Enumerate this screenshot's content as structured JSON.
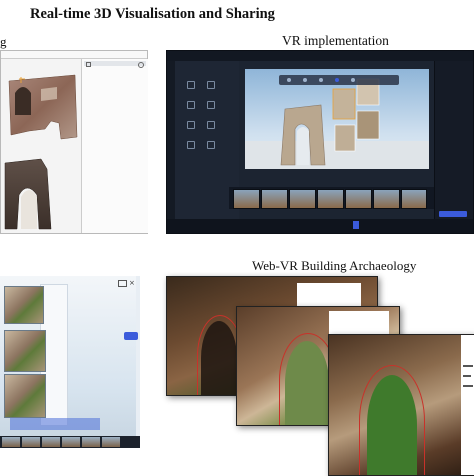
{
  "figure": {
    "title": "Real-time 3D Visualisation and Sharing",
    "captions": {
      "top_left": "g",
      "top_right": "VR implementation",
      "bottom_right": "Web-VR Building Archaeology"
    }
  },
  "colors": {
    "editor_dark": "#1c2431",
    "accent_blue": "#3b5bdb",
    "selection_orange": "#e8a23a",
    "annotation_red": "#c8322a"
  },
  "panels": {
    "top_left": {
      "icons": [
        "cube-icon",
        "gear-icon"
      ]
    },
    "top_right": {
      "icons": [
        "play-icon",
        "layers-icon",
        "settings-icon"
      ]
    },
    "bottom_left": {
      "icons": [
        "close-icon",
        "menu-icon"
      ]
    }
  }
}
